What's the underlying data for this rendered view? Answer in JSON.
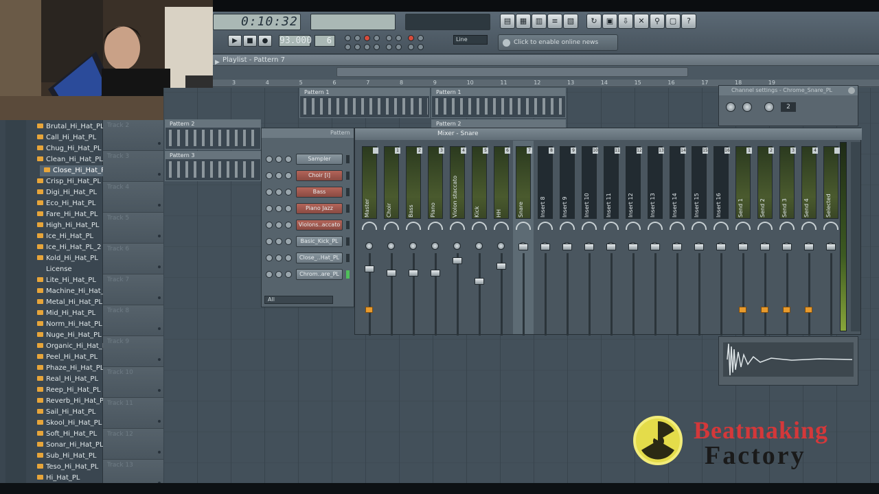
{
  "toolbar": {
    "time": "0:10:32",
    "time_label": "",
    "tempo": "93.000",
    "pattern": "6",
    "snap": "Line",
    "online_news": "Click to enable online news"
  },
  "playlist": {
    "title": "Playlist - Pattern 7",
    "timeline": [
      "3",
      "4",
      "5",
      "6",
      "7",
      "8",
      "9",
      "10",
      "11",
      "12",
      "13",
      "14",
      "15",
      "16",
      "17",
      "18",
      "19"
    ],
    "tracks": [
      "Track 2",
      "Track 3",
      "Track 4",
      "Track 5",
      "Track 6",
      "Track 7",
      "Track 8",
      "Track 9",
      "Track 10",
      "Track 11",
      "Track 12",
      "Track 13"
    ],
    "clips": [
      {
        "label": "Pattern 1"
      },
      {
        "label": "Pattern 1"
      },
      {
        "label": "Pattern 2"
      },
      {
        "label": "Pattern 2"
      },
      {
        "label": "Pattern 3"
      }
    ]
  },
  "browser": {
    "items": [
      "Brutal_Hi_Hat_PL",
      "Call_Hi_Hat_PL",
      "Chug_Hi_Hat_PL",
      "Clean_Hi_Hat_PL",
      "Close_Hi_Hat_PL",
      "Crisp_Hi_Hat_PL",
      "Digi_Hi_Hat_PL",
      "Eco_Hi_Hat_PL",
      "Fare_Hi_Hat_PL",
      "High_Hi_Hat_PL",
      "Ice_Hi_Hat_PL",
      "Ice_Hi_Hat_PL_2",
      "Kold_Hi_Hat_PL",
      "License",
      "Lite_Hi_Hat_PL",
      "Machine_Hi_Hat_PL",
      "Metal_Hi_Hat_PL",
      "Mid_Hi_Hat_PL",
      "Norm_Hi_Hat_PL",
      "Nuge_Hi_Hat_PL",
      "Organic_Hi_Hat_PL",
      "Peel_Hi_Hat_PL",
      "Phaze_Hi_Hat_PL",
      "Real_Hi_Hat_PL",
      "Reep_Hi_Hat_PL",
      "Reverb_Hi_Hat_PL",
      "Sail_Hi_Hat_PL",
      "Skool_Hi_Hat_PL",
      "Soft_Hi_Hat_PL",
      "Sonar_Hi_Hat_PL",
      "Sub_Hi_Hat_PL",
      "Teso_Hi_Hat_PL",
      "Hi_Hat_PL"
    ],
    "selected": "Close_Hi_Hat_PL"
  },
  "rack": {
    "title": "Pattern",
    "channels": [
      {
        "name": "Sampler",
        "color": "plain"
      },
      {
        "name": "Choir [i]",
        "color": "red"
      },
      {
        "name": "Bass",
        "color": "red"
      },
      {
        "name": "Piano Jazz",
        "color": "red"
      },
      {
        "name": "Violons..accato",
        "color": "red"
      },
      {
        "name": "Basic_Kick_PL",
        "color": "plain"
      },
      {
        "name": "Close_..Hat_PL",
        "color": "plain"
      },
      {
        "name": "Chrom..are_PL",
        "color": "plain"
      }
    ],
    "filter": "All"
  },
  "mixer": {
    "title": "Mixer - Snare",
    "strips": [
      {
        "name": "Master",
        "num": ""
      },
      {
        "name": "Choir",
        "num": "1"
      },
      {
        "name": "Bass",
        "num": "2"
      },
      {
        "name": "Piano",
        "num": "3"
      },
      {
        "name": "Violon staccato",
        "num": "4"
      },
      {
        "name": "Kick",
        "num": "5"
      },
      {
        "name": "HH",
        "num": "6"
      },
      {
        "name": "Snare",
        "num": "7"
      },
      {
        "name": "Insert 8",
        "num": "8"
      },
      {
        "name": "Insert 9",
        "num": "9"
      },
      {
        "name": "Insert 10",
        "num": "10"
      },
      {
        "name": "Insert 11",
        "num": "11"
      },
      {
        "name": "Insert 12",
        "num": "12"
      },
      {
        "name": "Insert 13",
        "num": "13"
      },
      {
        "name": "Insert 14",
        "num": "14"
      },
      {
        "name": "Insert 15",
        "num": "15"
      },
      {
        "name": "Insert 16",
        "num": "16"
      },
      {
        "name": "Send 1",
        "num": "1"
      },
      {
        "name": "Send 2",
        "num": "2"
      },
      {
        "name": "Send 3",
        "num": "3"
      },
      {
        "name": "Send 4",
        "num": "4"
      },
      {
        "name": "Selected",
        "num": ""
      }
    ]
  },
  "channel_settings": {
    "title": "Channel settings - Chrome_Snare_PL",
    "pitch": "2"
  },
  "logo": {
    "line1": "Beatmaking",
    "line2": "Factory"
  }
}
